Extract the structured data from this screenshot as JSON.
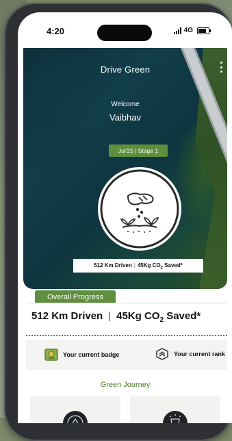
{
  "status_bar": {
    "time": "4:20",
    "network": "4G"
  },
  "hero": {
    "title": "Drive Green",
    "welcome": "Welcome",
    "user_name": "Vaibhav",
    "stage": "Jul'25 | Stage 1",
    "stats": {
      "km": "512 Km Driven",
      "co2_prefix": "45Kg CO",
      "co2_sub": "2",
      "co2_suffix": " Saved*"
    }
  },
  "overall_progress": {
    "label": "Overall Progress",
    "km": "512 Km Driven",
    "co2_prefix": "45Kg CO",
    "co2_sub": "2",
    "co2_suffix": " Saved*"
  },
  "badges": {
    "current_badge": "Your current badge",
    "current_rank": "Your current rank"
  },
  "green_journey": {
    "title": "Green Journey"
  },
  "colors": {
    "brand_green": "#5f8f3e",
    "title_green": "#4f7d30"
  }
}
